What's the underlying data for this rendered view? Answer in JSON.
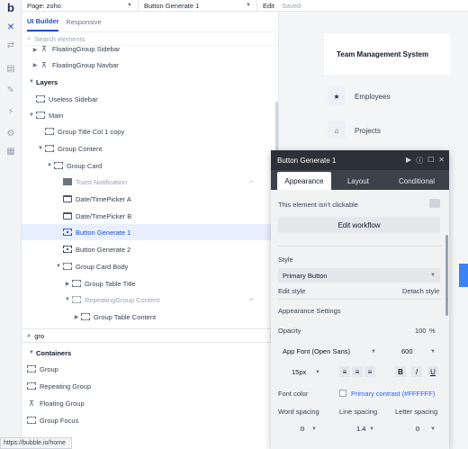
{
  "topbar": {
    "page_label": "Page: zoho",
    "element_label": "Button Generate 1",
    "edit_label": "Edit",
    "saved_label": "Saved"
  },
  "panel": {
    "tabs": [
      "UI Builder",
      "Responsive"
    ],
    "search_placeholder": "Search elements",
    "tree": [
      {
        "label": "FloatingGroup Sidebar",
        "indent": 1
      },
      {
        "label": "FloatingGroup Navbar",
        "indent": 1
      },
      {
        "label": "Layers",
        "indent": 0
      },
      {
        "label": "Useless Sidebar",
        "indent": 1
      },
      {
        "label": "Main",
        "indent": 1
      },
      {
        "label": "Group Title Col 1 copy",
        "indent": 2
      },
      {
        "label": "Group Content",
        "indent": 2
      },
      {
        "label": "Group Card",
        "indent": 3
      },
      {
        "label": "Toast Notification",
        "indent": 4
      },
      {
        "label": "Date/TimePicker A",
        "indent": 4
      },
      {
        "label": "Date/TimePicker B",
        "indent": 4
      },
      {
        "label": "Button Generate 1",
        "indent": 4
      },
      {
        "label": "Button Generate 2",
        "indent": 4
      },
      {
        "label": "Group Card Body",
        "indent": 4
      },
      {
        "label": "Group Table Title",
        "indent": 5
      },
      {
        "label": "RepeatingGroup Content",
        "indent": 5
      },
      {
        "label": "Group Table Content",
        "indent": 6
      }
    ],
    "search2_value": "gro",
    "containers_header": "Containers",
    "containers": [
      "Group",
      "Repeating Group",
      "Floating Group",
      "Group Focus"
    ]
  },
  "canvas": {
    "card_title": "Team Management System",
    "nav": [
      "Employees",
      "Projects"
    ]
  },
  "modal": {
    "title": "Button Generate 1",
    "tabs": [
      "Appearance",
      "Layout",
      "Conditional"
    ],
    "not_clickable": "This element isn't clickable",
    "edit_workflow": "Edit workflow",
    "style_label": "Style",
    "style_value": "Primary Button",
    "edit_style": "Edit style",
    "detach_style": "Detach style",
    "appearance_settings": "Appearance Settings",
    "opacity_label": "Opacity",
    "opacity_value": "100",
    "opacity_unit": "%",
    "font_family": "App Font (Open Sans)",
    "font_weight": "600",
    "font_size": "15px",
    "font_color_label": "Font color",
    "font_color_value": "Primary contrast (#FFFFFF)",
    "word_spacing_label": "Word spacing",
    "line_spacing_label": "Line spacing",
    "letter_spacing_label": "Letter spacing",
    "word_spacing": "0",
    "line_spacing": "1.4",
    "letter_spacing": "0",
    "bold": "B",
    "italic": "I",
    "underline": "U"
  },
  "status_url": "https://bubble.io/home",
  "colors": {
    "accent": "#1d4ed8",
    "modal_header": "#2d3038",
    "font_color": "#2563eb"
  }
}
